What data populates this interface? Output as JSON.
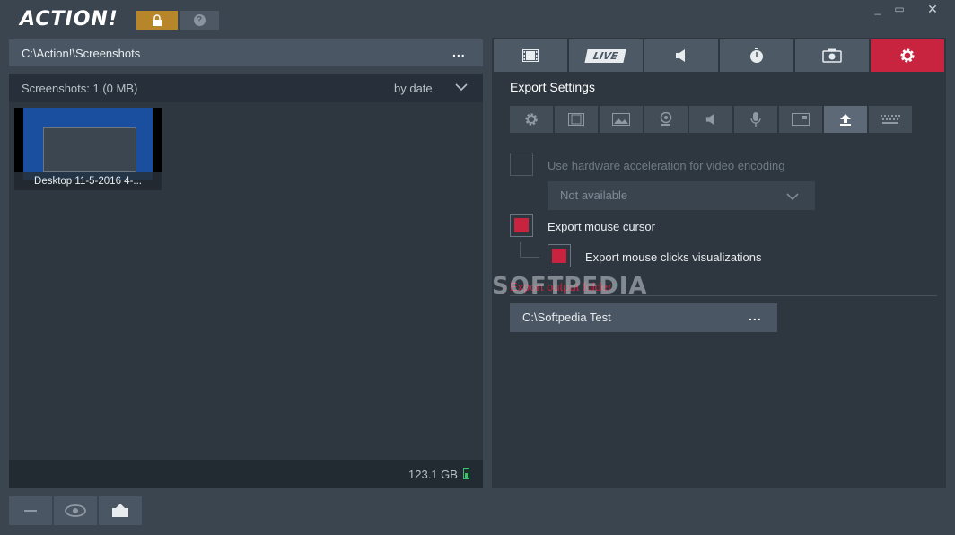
{
  "app": {
    "logo_text": "ACTION!",
    "help_label": "?"
  },
  "window_controls": {
    "minimize": "_",
    "maximize": "▭",
    "close": "✕"
  },
  "left": {
    "path": "C:\\Action!\\Screenshots",
    "path_more": "...",
    "header_count": "Screenshots: 1 (0 MB)",
    "sort": "by date",
    "thumbnail_label": "Desktop 11-5-2016 4-...",
    "storage": "123.1 GB"
  },
  "bottom_buttons": {
    "minus_icon": "minus-icon",
    "eye_icon": "eye-icon",
    "export_icon": "export-icon"
  },
  "main_tabs": [
    {
      "name": "video-tab",
      "icon": "film-icon"
    },
    {
      "name": "live-tab",
      "label": "LIVE"
    },
    {
      "name": "audio-tab",
      "icon": "speaker-icon"
    },
    {
      "name": "benchmark-tab",
      "icon": "stopwatch-icon"
    },
    {
      "name": "screenshot-tab",
      "icon": "camera-icon"
    },
    {
      "name": "settings-tab",
      "icon": "gear-icon",
      "active": true
    }
  ],
  "settings": {
    "title": "Export Settings",
    "sub_tabs": [
      "gear-icon",
      "film-icon",
      "image-icon",
      "webcam-icon",
      "speaker-icon",
      "microphone-icon",
      "window-icon",
      "export-icon",
      "keyboard-icon"
    ],
    "active_sub_tab": 7,
    "hw_accel_label": "Use hardware acceleration for video encoding",
    "hw_accel_select": "Not available",
    "mouse_cursor_label": "Export mouse cursor",
    "mouse_clicks_label": "Export mouse clicks visualizations",
    "output_folder_label": "Export output folder",
    "output_path": "C:\\Softpedia Test",
    "output_more": "..."
  },
  "watermark": "SOFTPEDIA",
  "colors": {
    "accent": "#c8233f",
    "lock": "#b8862a",
    "background": "#3a4550",
    "panel": "#2e3740"
  }
}
